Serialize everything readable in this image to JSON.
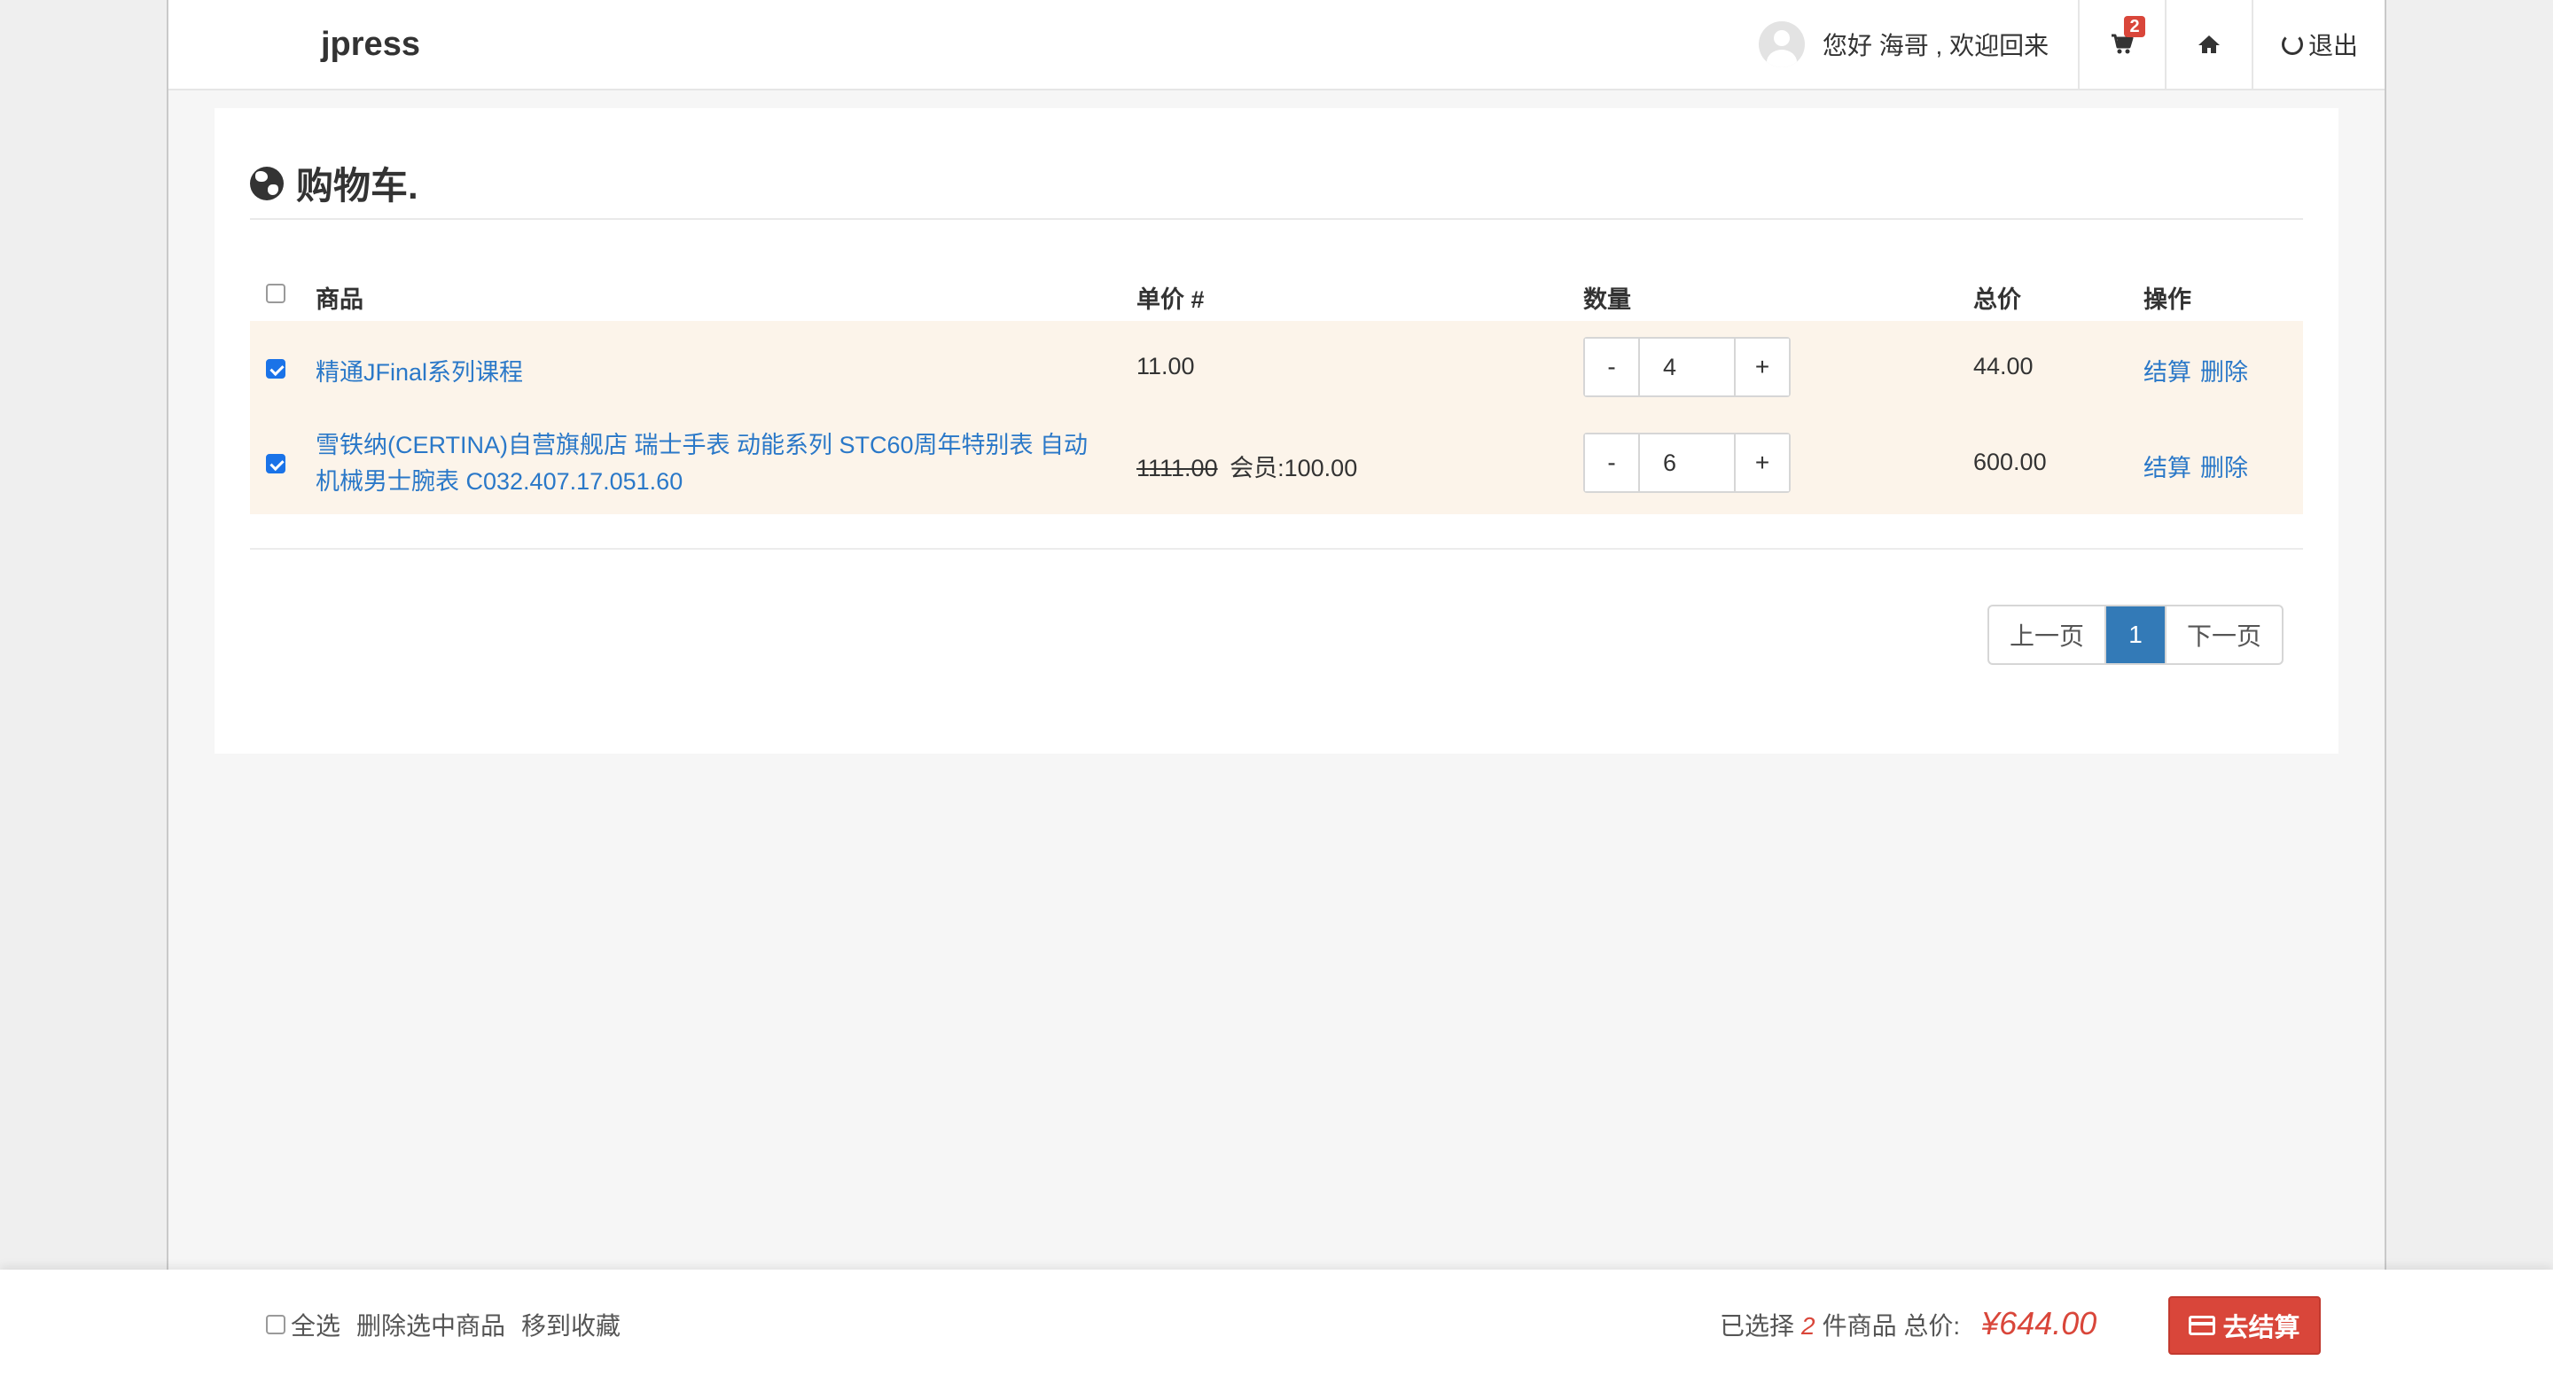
{
  "navbar": {
    "brand": "jpress",
    "greeting": "您好 海哥 , 欢迎回来",
    "cart_count": "2",
    "logout_label": "退出"
  },
  "panel": {
    "title": "购物车."
  },
  "table": {
    "headers": {
      "product": "商品",
      "unit_price": "单价 #",
      "quantity": "数量",
      "total": "总价",
      "actions": "操作"
    },
    "rows": [
      {
        "checked": true,
        "name": "精通JFinal系列课程",
        "name_line2": "",
        "original_price": "",
        "price": "11.00",
        "member_label": "",
        "qty_minus": "-",
        "qty": "4",
        "qty_plus": "+",
        "total": "44.00",
        "action_checkout": "结算",
        "action_delete": "删除"
      },
      {
        "checked": true,
        "name": "雪铁纳(CERTINA)自营旗舰店 瑞士手表 动能系列 STC60周年特别表 自动",
        "name_line2": "机械男士腕表 C032.407.17.051.60",
        "original_price": "1111.00",
        "price": "100.00",
        "member_label": "会员:",
        "qty_minus": "-",
        "qty": "6",
        "qty_plus": "+",
        "total": "600.00",
        "action_checkout": "结算",
        "action_delete": "删除"
      }
    ]
  },
  "pagination": {
    "prev": "上一页",
    "current": "1",
    "next": "下一页"
  },
  "footer": {
    "select_all": "全选",
    "delete_selected": "删除选中商品",
    "move_to_favorites": "移到收藏",
    "selected_prefix": "已选择",
    "selected_count": "2",
    "selected_suffix": "件商品 总价:",
    "total_price": "¥644.00",
    "checkout_label": "去结算"
  },
  "colors": {
    "accent_blue": "#337ab7",
    "link_blue": "#2a78c8",
    "danger_red": "#d9463a",
    "row_highlight": "#fcf4ea"
  }
}
